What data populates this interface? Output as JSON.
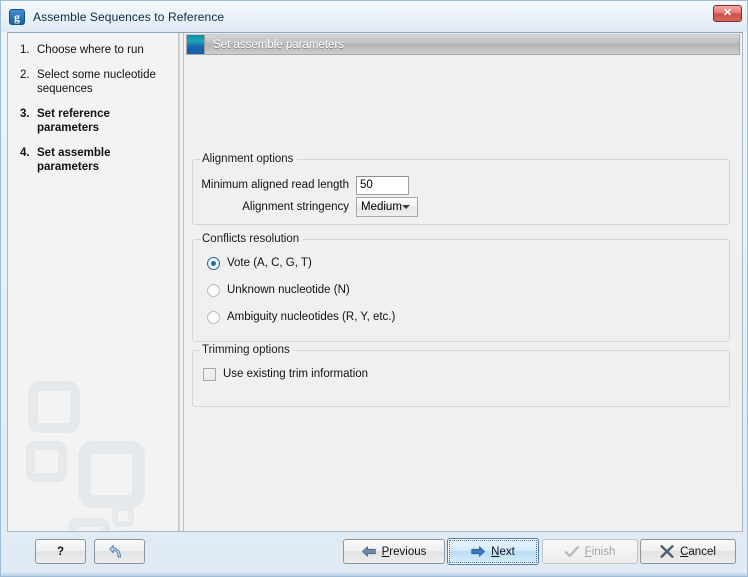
{
  "window": {
    "title": "Assemble Sequences to Reference",
    "app_icon": "g",
    "close_label": "✕"
  },
  "sidebar": {
    "steps": [
      {
        "num": "1.",
        "label": "Choose where to run",
        "state": "done"
      },
      {
        "num": "2.",
        "label": "Select some nucleotide sequences",
        "state": "done"
      },
      {
        "num": "3.",
        "label": "Set reference parameters",
        "state": "active"
      },
      {
        "num": "4.",
        "label": "Set assemble parameters",
        "state": "active"
      }
    ]
  },
  "panel": {
    "header_title": "Set assemble parameters"
  },
  "alignment_options": {
    "legend": "Alignment options",
    "min_read_length_label": "Minimum aligned read length",
    "min_read_length_value": "50",
    "stringency_label": "Alignment stringency",
    "stringency_value": "Medium",
    "stringency_options": [
      "Medium"
    ]
  },
  "conflicts_resolution": {
    "legend": "Conflicts resolution",
    "options": [
      {
        "label": "Vote (A, C, G, T)",
        "selected": true
      },
      {
        "label": "Unknown nucleotide (N)",
        "selected": false
      },
      {
        "label": "Ambiguity nucleotides (R, Y, etc.)",
        "selected": false
      }
    ]
  },
  "trimming_options": {
    "legend": "Trimming options",
    "use_existing_trim_label": "Use existing trim information",
    "use_existing_trim_checked": false
  },
  "buttons": {
    "help": "?",
    "reset": "reset-icon",
    "previous_pre": "",
    "previous_mnemonic": "P",
    "previous_post": "revious",
    "next_pre": "",
    "next_mnemonic": "N",
    "next_post": "ext",
    "finish_pre": "",
    "finish_mnemonic": "F",
    "finish_post": "inish",
    "cancel_pre": "",
    "cancel_mnemonic": "C",
    "cancel_post": "ancel",
    "finish_enabled": false,
    "next_focused": true
  },
  "colors": {
    "accent_blue": "#1c6bb0",
    "header_icon_teal": "#1ca8bb",
    "close_red": "#c94f45",
    "frame_blue": "#9fbdd6"
  }
}
